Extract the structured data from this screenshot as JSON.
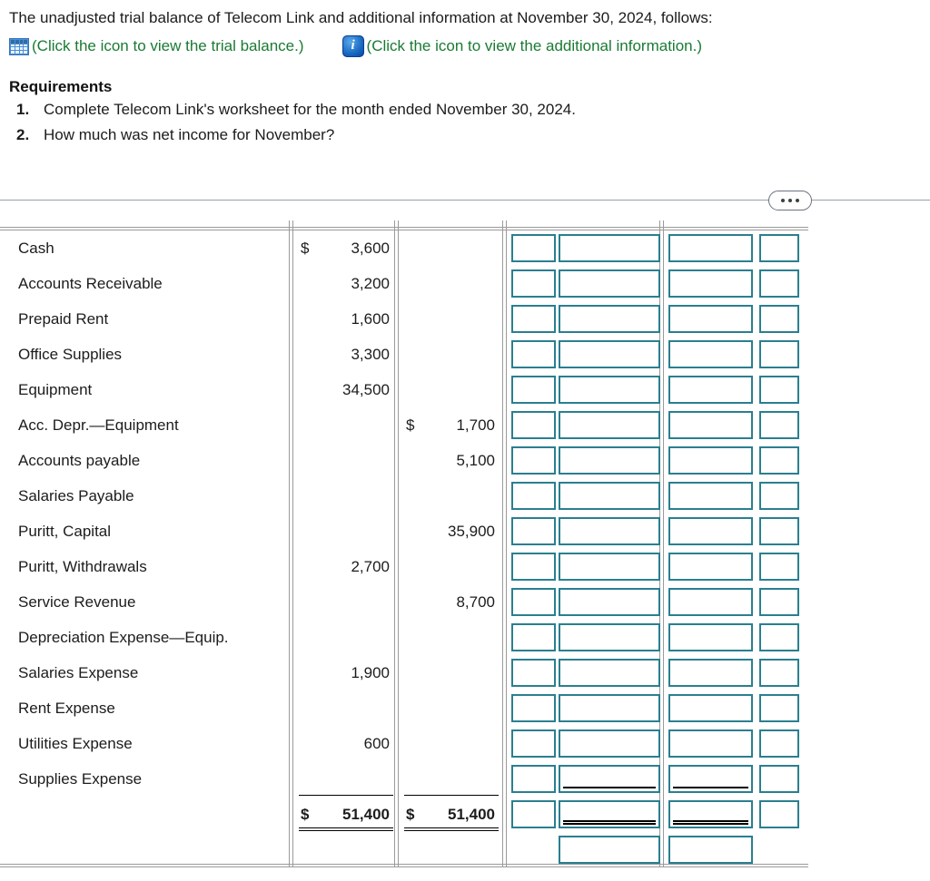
{
  "prompt": {
    "intro": "The unadjusted trial balance of Telecom Link and additional information at November 30, 2024, follows:",
    "links": [
      {
        "icon": "table-grid-icon",
        "text": "(Click the icon to view the trial balance.)"
      },
      {
        "icon": "info-icon",
        "text": "(Click the icon to view the additional information.)"
      }
    ],
    "link_color": "#1a7a33"
  },
  "requirements": {
    "title": "Requirements",
    "items": [
      {
        "num": "1.",
        "text": "Complete Telecom Link's worksheet for the month ended November 30, 2024."
      },
      {
        "num": "2.",
        "text": "How much was net income for November?"
      }
    ]
  },
  "divider": {
    "ellipsis": "•••"
  },
  "worksheet": {
    "accent_color": "#2a7f8f",
    "rule_color": "#9a9a9a",
    "rows": [
      {
        "label": "Cash",
        "debit_cur": "$",
        "debit": "3,600",
        "credit_cur": "",
        "credit": ""
      },
      {
        "label": "Accounts Receivable",
        "debit_cur": "",
        "debit": "3,200",
        "credit_cur": "",
        "credit": ""
      },
      {
        "label": "Prepaid Rent",
        "debit_cur": "",
        "debit": "1,600",
        "credit_cur": "",
        "credit": ""
      },
      {
        "label": "Office Supplies",
        "debit_cur": "",
        "debit": "3,300",
        "credit_cur": "",
        "credit": ""
      },
      {
        "label": "Equipment",
        "debit_cur": "",
        "debit": "34,500",
        "credit_cur": "",
        "credit": ""
      },
      {
        "label": "Acc. Depr.—Equipment",
        "debit_cur": "",
        "debit": "",
        "credit_cur": "$",
        "credit": "1,700"
      },
      {
        "label": "Accounts payable",
        "debit_cur": "",
        "debit": "",
        "credit_cur": "",
        "credit": "5,100"
      },
      {
        "label": "Salaries Payable",
        "debit_cur": "",
        "debit": "",
        "credit_cur": "",
        "credit": ""
      },
      {
        "label": "Puritt, Capital",
        "debit_cur": "",
        "debit": "",
        "credit_cur": "",
        "credit": "35,900"
      },
      {
        "label": "Puritt, Withdrawals",
        "debit_cur": "",
        "debit": "2,700",
        "credit_cur": "",
        "credit": ""
      },
      {
        "label": "Service Revenue",
        "debit_cur": "",
        "debit": "",
        "credit_cur": "",
        "credit": "8,700"
      },
      {
        "label": "Depreciation Expense—Equip.",
        "debit_cur": "",
        "debit": "",
        "credit_cur": "",
        "credit": ""
      },
      {
        "label": "Salaries Expense",
        "debit_cur": "",
        "debit": "1,900",
        "credit_cur": "",
        "credit": ""
      },
      {
        "label": "Rent Expense",
        "debit_cur": "",
        "debit": "",
        "credit_cur": "",
        "credit": ""
      },
      {
        "label": "Utilities Expense",
        "debit_cur": "",
        "debit": "600",
        "credit_cur": "",
        "credit": ""
      },
      {
        "label": "Supplies Expense",
        "debit_cur": "",
        "debit": "",
        "credit_cur": "",
        "credit": ""
      }
    ],
    "totals": {
      "debit_cur": "$",
      "debit": "51,400",
      "credit_cur": "$",
      "credit": "51,400"
    },
    "input_columns": [
      {
        "name": "col-1",
        "box_count": 17,
        "decorations": {}
      },
      {
        "name": "col-2",
        "box_count": 18,
        "decorations": {
          "16": "underline",
          "17": "double-underline"
        }
      },
      {
        "name": "col-3",
        "box_count": 18,
        "decorations": {
          "16": "underline",
          "17": "double-underline"
        }
      },
      {
        "name": "col-4",
        "box_count": 17,
        "decorations": {}
      }
    ]
  }
}
